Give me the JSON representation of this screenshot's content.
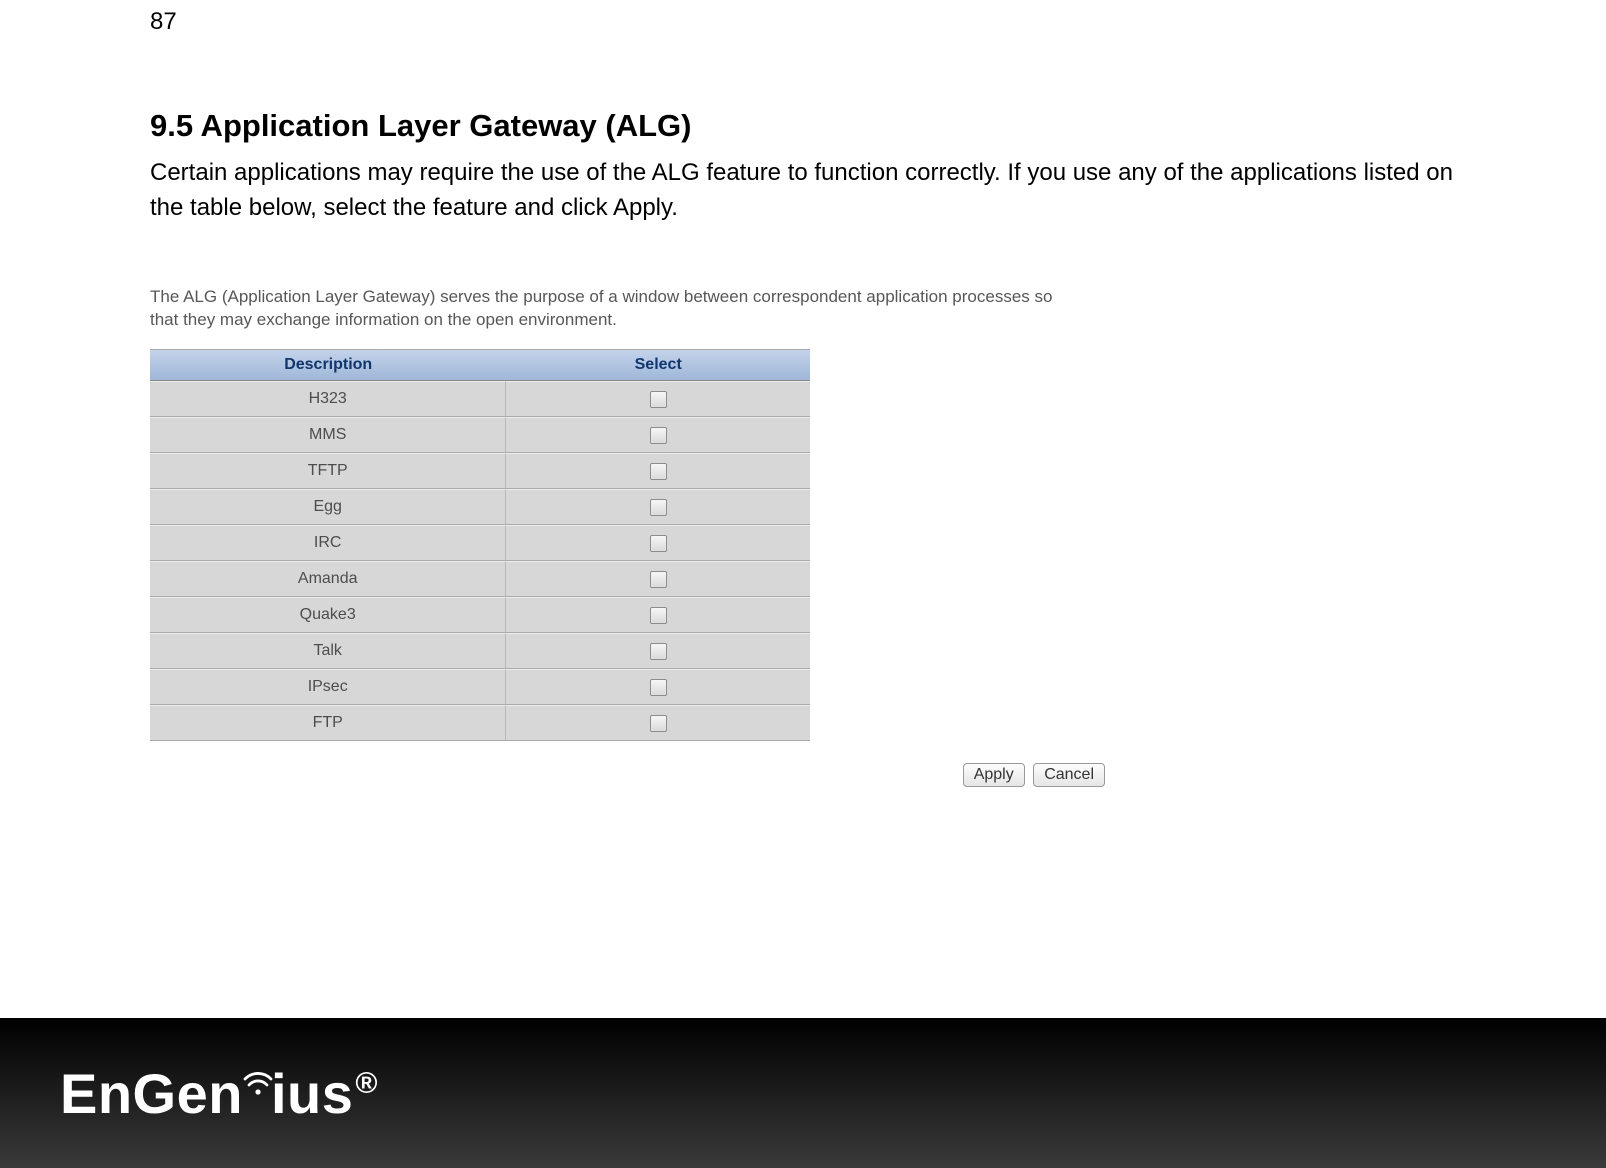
{
  "page": {
    "number": "87"
  },
  "heading": "9.5    Application Layer Gateway (ALG)",
  "description": "Certain applications may require the use of the ALG feature to function correctly. If you use any of the applications listed on the table below, select the feature and click Apply.",
  "sub_note": "The ALG (Application Layer Gateway) serves the purpose of a window between correspondent application processes so that they may exchange information on the open environment.",
  "table": {
    "headers": {
      "desc": "Description",
      "select": "Select"
    },
    "rows": [
      {
        "desc": "H323",
        "checked": false
      },
      {
        "desc": "MMS",
        "checked": false
      },
      {
        "desc": "TFTP",
        "checked": false
      },
      {
        "desc": "Egg",
        "checked": false
      },
      {
        "desc": "IRC",
        "checked": false
      },
      {
        "desc": "Amanda",
        "checked": false
      },
      {
        "desc": "Quake3",
        "checked": false
      },
      {
        "desc": "Talk",
        "checked": false
      },
      {
        "desc": "IPsec",
        "checked": false
      },
      {
        "desc": "FTP",
        "checked": false
      }
    ]
  },
  "buttons": {
    "apply": "Apply",
    "cancel": "Cancel"
  },
  "footer": {
    "brand": "EnGenius",
    "registered": "®"
  }
}
